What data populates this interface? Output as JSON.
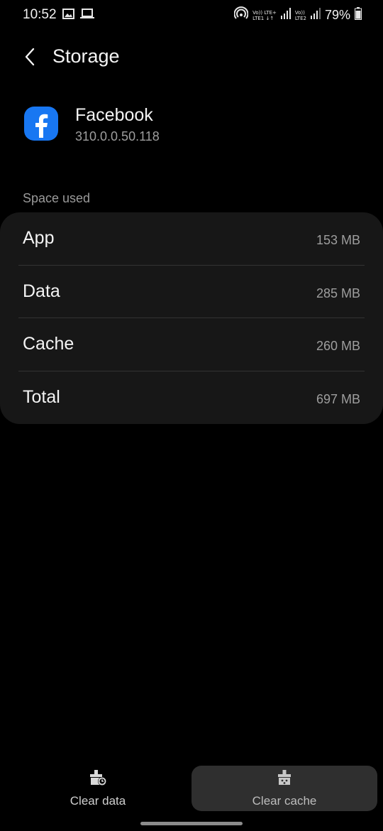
{
  "status_bar": {
    "time": "10:52",
    "network_sim1_top": "Vo)) LTE+",
    "network_sim1_bottom": "LTE1 ↓↑",
    "network_sim2_top": "Vo))",
    "network_sim2_bottom": "LTE2",
    "battery": "79%"
  },
  "header": {
    "title": "Storage"
  },
  "app": {
    "name": "Facebook",
    "version": "310.0.0.50.118",
    "icon_color": "#1877f2"
  },
  "space_used": {
    "title": "Space used",
    "rows": [
      {
        "label": "App",
        "value": "153 MB"
      },
      {
        "label": "Data",
        "value": "285 MB"
      },
      {
        "label": "Cache",
        "value": "260 MB"
      },
      {
        "label": "Total",
        "value": "697 MB"
      }
    ]
  },
  "actions": {
    "clear_data": "Clear data",
    "clear_cache": "Clear cache"
  }
}
